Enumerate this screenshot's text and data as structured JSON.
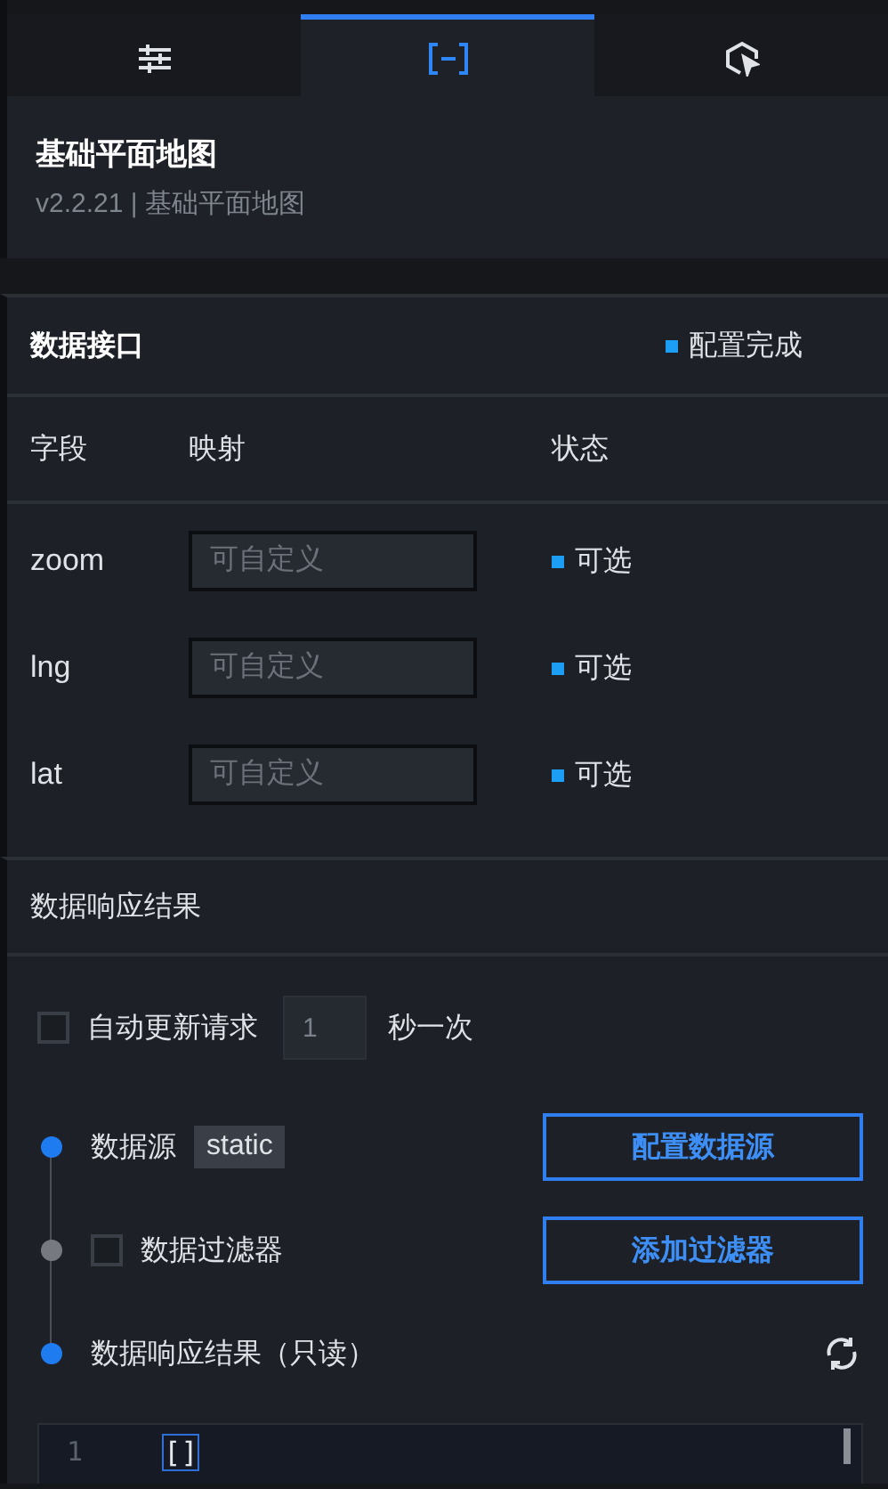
{
  "tabs": [
    {
      "kind": "settings",
      "selected": false
    },
    {
      "kind": "data",
      "selected": true
    },
    {
      "kind": "interaction",
      "selected": false
    }
  ],
  "header": {
    "title": "基础平面地图",
    "subtitle": "v2.2.21 | 基础平面地图"
  },
  "interface": {
    "title": "数据接口",
    "status": "配置完成",
    "columns": [
      "字段",
      "映射",
      "状态"
    ],
    "fields": [
      {
        "name": "zoom",
        "placeholder": "可自定义",
        "status": "可选"
      },
      {
        "name": "lng",
        "placeholder": "可自定义",
        "status": "可选"
      },
      {
        "name": "lat",
        "placeholder": "可自定义",
        "status": "可选"
      }
    ]
  },
  "response": {
    "title": "数据响应结果",
    "auto_update": {
      "label": "自动更新请求",
      "checked": false,
      "interval": "1",
      "disabled": true,
      "unit": "秒一次"
    },
    "steps": [
      {
        "kind": "source",
        "label": "数据源",
        "active": true,
        "tag": "static",
        "button": "配置数据源"
      },
      {
        "kind": "filter",
        "label": "数据过滤器",
        "active": false,
        "checked": false,
        "button": "添加过滤器"
      },
      {
        "kind": "result",
        "label": "数据响应结果（只读）",
        "active": true
      }
    ],
    "editor": {
      "lines": [
        {
          "number": "1",
          "code": "[]"
        }
      ]
    }
  }
}
